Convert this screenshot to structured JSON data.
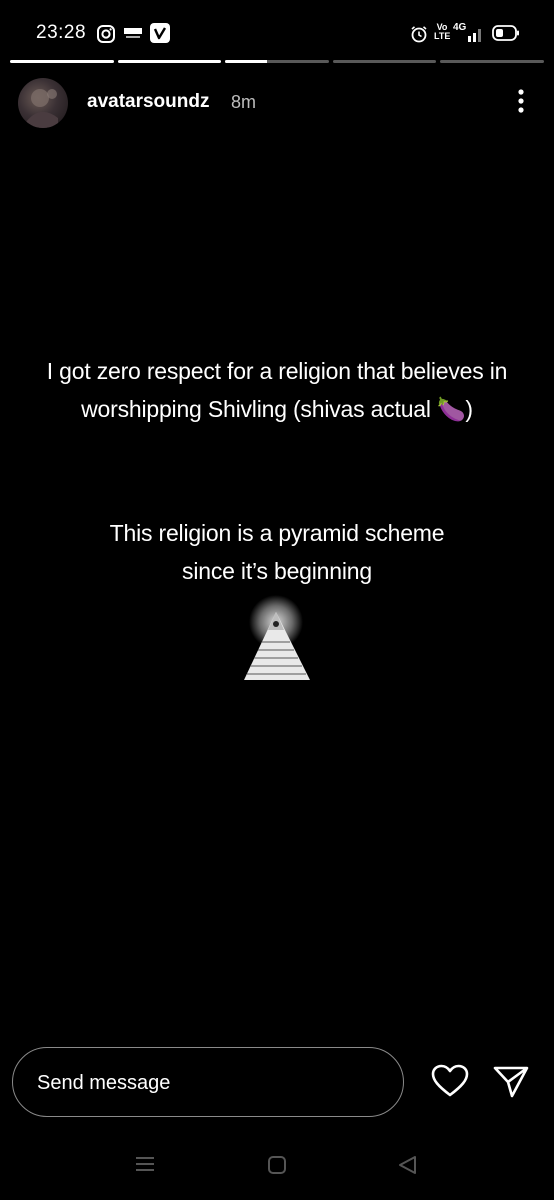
{
  "status_bar": {
    "time": "23:28",
    "left_icons": [
      "instagram-icon",
      "paytm-icon",
      "vimeo-icon"
    ],
    "right_icons": [
      "alarm-icon",
      "volte-icon",
      "signal-4g-icon",
      "battery-icon"
    ],
    "network_label": "4G",
    "volte_label": "Vo LTE"
  },
  "story": {
    "progress": [
      1,
      1,
      0.4,
      0,
      0
    ],
    "username": "avatarsoundz",
    "time_ago": "8m",
    "paragraph1": {
      "line1": "I got zero respect for a religion that believes in",
      "line2": "worshipping Shivling (shivas actual 🍆)"
    },
    "paragraph2": {
      "line1": "This religion is a pyramid scheme",
      "line2": "since it’s beginning"
    }
  },
  "reply": {
    "placeholder": "Send message"
  },
  "colors": {
    "background": "#000000",
    "text": "#ffffff",
    "muted": "#bdbdbd"
  }
}
